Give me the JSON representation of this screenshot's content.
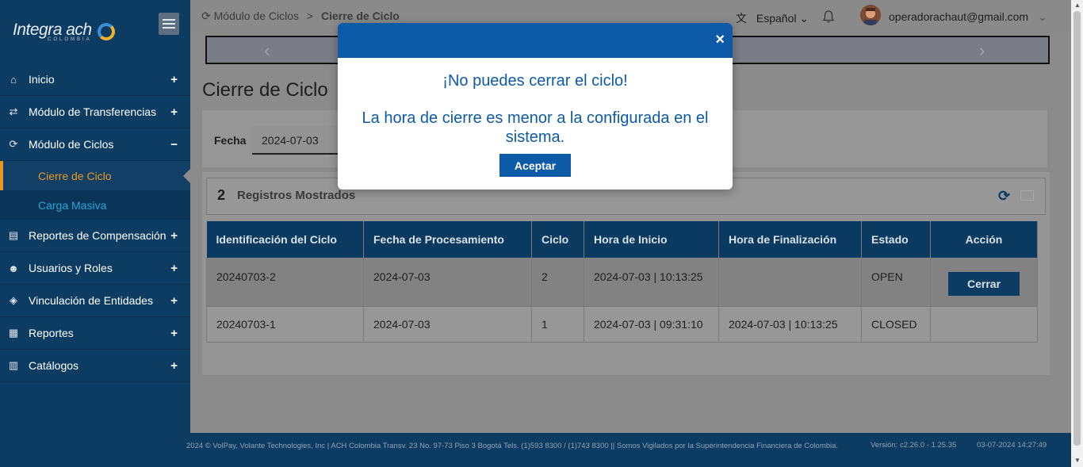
{
  "sidebar": {
    "logo": "Integra ach",
    "logo_sub": "COLOMBIA",
    "items": [
      {
        "label": "Inicio",
        "icon": "home-icon",
        "toggle": "+"
      },
      {
        "label": "Módulo de Transferencias",
        "icon": "exchange-icon",
        "toggle": "+"
      },
      {
        "label": "Módulo de Ciclos",
        "icon": "refresh-icon",
        "toggle": "−"
      },
      {
        "label": "Reportes de Compensación",
        "icon": "file-icon",
        "toggle": "+"
      },
      {
        "label": "Usuarios y Roles",
        "icon": "users-icon",
        "toggle": "+"
      },
      {
        "label": "Vinculación de Entidades",
        "icon": "link-icon",
        "toggle": "+"
      },
      {
        "label": "Reportes",
        "icon": "document-icon",
        "toggle": "+"
      },
      {
        "label": "Catálogos",
        "icon": "book-icon",
        "toggle": "+"
      }
    ],
    "subitems": [
      {
        "label": "Cierre de Ciclo",
        "active": true
      },
      {
        "label": "Carga Masiva",
        "active": false
      }
    ]
  },
  "header": {
    "breadcrumb_parent": "Módulo de Ciclos",
    "breadcrumb_sep": ">",
    "breadcrumb_current": "Cierre de Ciclo",
    "language": "Español",
    "user_email": "operadorachaut@gmail.com"
  },
  "main": {
    "title": "Cierre de Ciclo",
    "filter_label": "Fecha",
    "filter_value": "2024-07-03",
    "record_count": "2",
    "record_label": "Registros Mostrados",
    "columns": [
      "Identificación del Ciclo",
      "Fecha de Procesamiento",
      "Ciclo",
      "Hora de Inicio",
      "Hora de Finalización",
      "Estado",
      "Acción"
    ],
    "rows": [
      {
        "id": "20240703-2",
        "fecha": "2024-07-03",
        "ciclo": "2",
        "inicio": "2024-07-03 | 10:13:25",
        "fin": "",
        "estado": "OPEN",
        "accion": "Cerrar"
      },
      {
        "id": "20240703-1",
        "fecha": "2024-07-03",
        "ciclo": "1",
        "inicio": "2024-07-03 | 09:31:10",
        "fin": "2024-07-03 | 10:13:25",
        "estado": "CLOSED",
        "accion": ""
      }
    ]
  },
  "modal": {
    "title": "¡No puedes cerrar el ciclo!",
    "message": "La hora de cierre es menor a la configurada en el sistema.",
    "button": "Aceptar",
    "close": "×"
  },
  "footer": {
    "text": "2024 © VolPay, Volante Technologies, Inc | ACH Colombia Transv. 23 No. 97-73 Piso 3 Bogotá Tels. (1)593 8300 / (1)743 8300 || Somos Vigilados por la Superintendencia Financiera de Colombia.",
    "version": "Versión: c2.26.0 - 1.25.35",
    "datetime": "03-07-2024 14:27:49"
  },
  "colors": {
    "sidebar": "#0d3c63",
    "accent": "#0d5aa7",
    "active": "#e89a20"
  }
}
